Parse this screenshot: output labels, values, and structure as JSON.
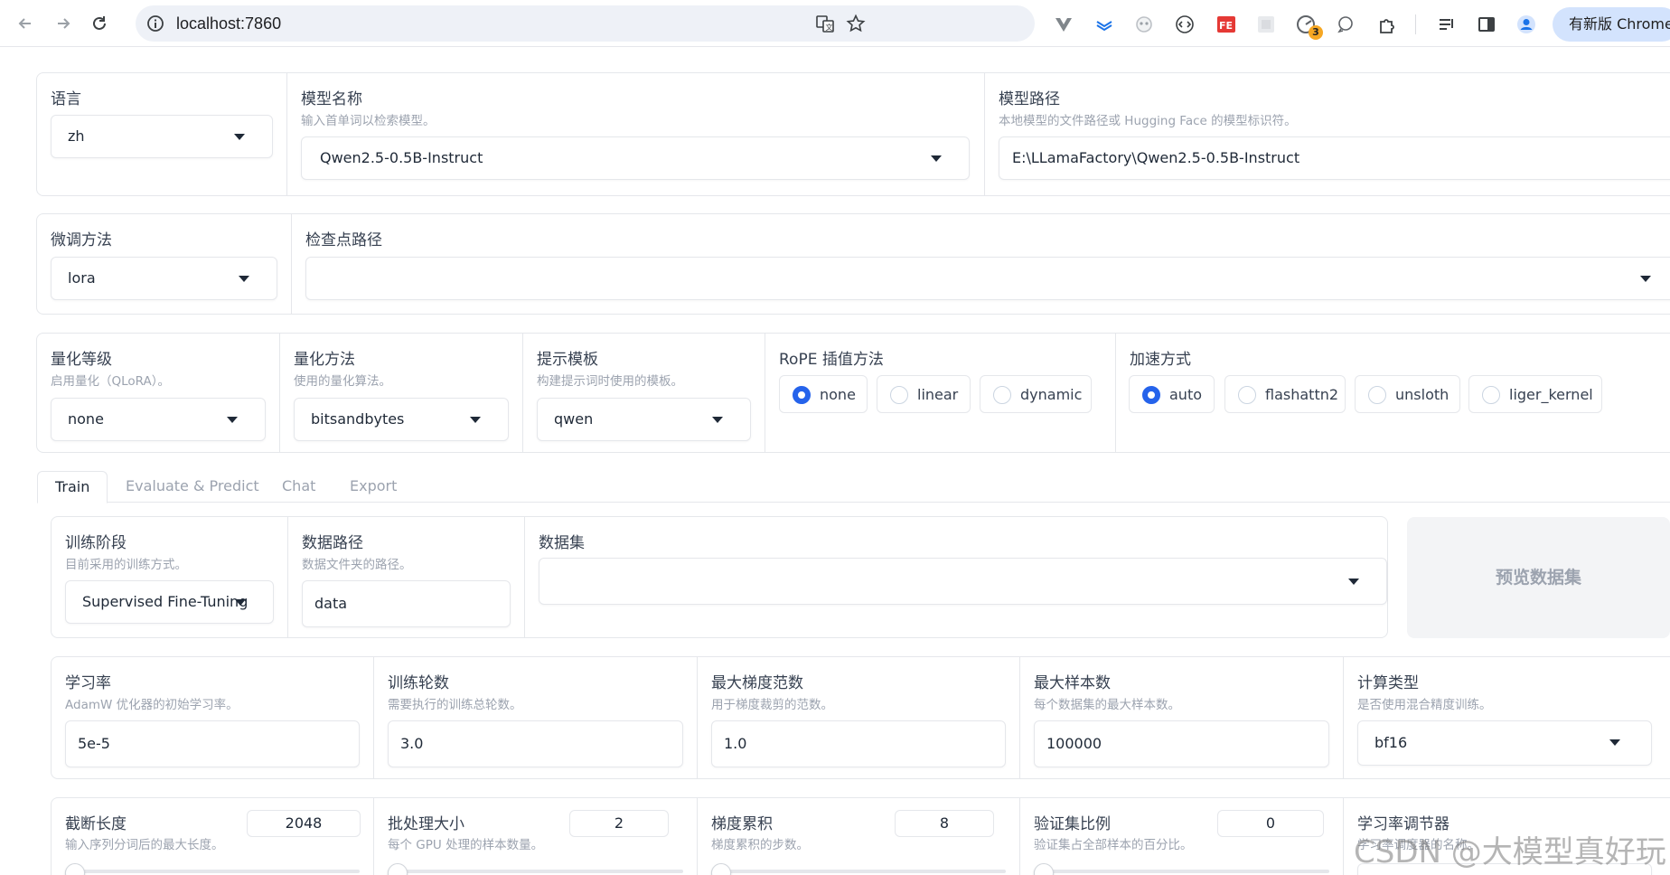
{
  "browser": {
    "url": "localhost:7860",
    "update_label": "有新版 Chrome",
    "extension_badge": "3"
  },
  "top": {
    "lang": {
      "label": "语言",
      "value": "zh"
    },
    "model_name": {
      "label": "模型名称",
      "info": "输入首单词以检索模型。",
      "value": "Qwen2.5-0.5B-Instruct"
    },
    "model_path": {
      "label": "模型路径",
      "info": "本地模型的文件路径或 Hugging Face 的模型标识符。",
      "value": "E:\\LLamaFactory\\Qwen2.5-0.5B-Instruct"
    }
  },
  "row2": {
    "finetune": {
      "label": "微调方法",
      "value": "lora"
    },
    "checkpoint": {
      "label": "检查点路径",
      "value": ""
    }
  },
  "row3": {
    "quant_bit": {
      "label": "量化等级",
      "info": "启用量化（QLoRA）。",
      "value": "none"
    },
    "quant_method": {
      "label": "量化方法",
      "info": "使用的量化算法。",
      "value": "bitsandbytes"
    },
    "template": {
      "label": "提示模板",
      "info": "构建提示词时使用的模板。",
      "value": "qwen"
    },
    "rope": {
      "label": "RoPE 插值方法",
      "options": [
        "none",
        "linear",
        "dynamic"
      ],
      "selected": "none"
    },
    "booster": {
      "label": "加速方式",
      "options": [
        "auto",
        "flashattn2",
        "unsloth",
        "liger_kernel"
      ],
      "selected": "auto"
    }
  },
  "tabs": [
    "Train",
    "Evaluate & Predict",
    "Chat",
    "Export"
  ],
  "train": {
    "stage": {
      "label": "训练阶段",
      "info": "目前采用的训练方式。",
      "value": "Supervised Fine-Tuning"
    },
    "dataset_dir": {
      "label": "数据路径",
      "info": "数据文件夹的路径。",
      "value": "data"
    },
    "dataset": {
      "label": "数据集",
      "value": ""
    },
    "preview_label": "预览数据集",
    "learning_rate": {
      "label": "学习率",
      "info": "AdamW 优化器的初始学习率。",
      "value": "5e-5"
    },
    "epochs": {
      "label": "训练轮数",
      "info": "需要执行的训练总轮数。",
      "value": "3.0"
    },
    "max_grad_norm": {
      "label": "最大梯度范数",
      "info": "用于梯度裁剪的范数。",
      "value": "1.0"
    },
    "max_samples": {
      "label": "最大样本数",
      "info": "每个数据集的最大样本数。",
      "value": "100000"
    },
    "compute_type": {
      "label": "计算类型",
      "info": "是否使用混合精度训练。",
      "value": "bf16"
    },
    "cutoff_len": {
      "label": "截断长度",
      "info": "输入序列分词后的最大长度。",
      "value": "2048"
    },
    "batch_size": {
      "label": "批处理大小",
      "info": "每个 GPU 处理的样本数量。",
      "value": "2"
    },
    "grad_accum": {
      "label": "梯度累积",
      "info": "梯度累积的步数。",
      "value": "8"
    },
    "val_size": {
      "label": "验证集比例",
      "info": "验证集占全部样本的百分比。",
      "value": "0"
    },
    "lr_scheduler": {
      "label": "学习率调节器",
      "info": "学习率调度器的名称。"
    }
  },
  "watermark": "CSDN @大模型真好玩"
}
